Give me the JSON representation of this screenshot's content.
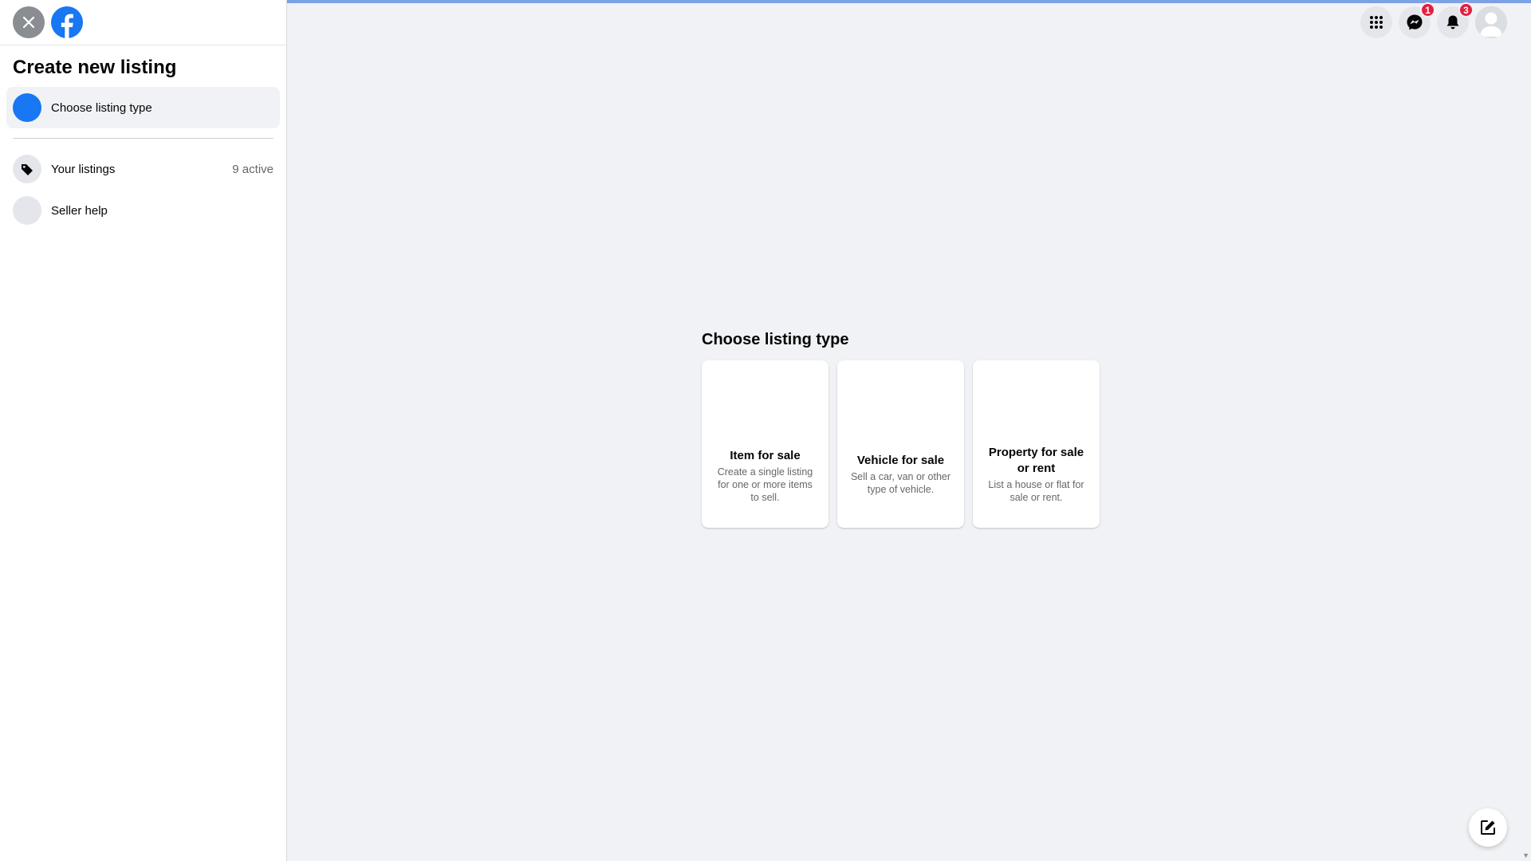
{
  "sidebar": {
    "title": "Create new listing",
    "items": [
      {
        "label": "Choose listing type",
        "meta": "",
        "icon": "step-circle-icon",
        "active": true
      },
      {
        "label": "Your listings",
        "meta": "9 active",
        "icon": "tag-icon"
      },
      {
        "label": "Seller help",
        "meta": "",
        "icon": "help-icon"
      }
    ]
  },
  "header": {
    "messenger_badge": "1",
    "notifications_badge": "3"
  },
  "main": {
    "title": "Choose listing type",
    "cards": [
      {
        "title": "Item for sale",
        "desc": "Create a single listing for one or more items to sell."
      },
      {
        "title": "Vehicle for sale",
        "desc": "Sell a car, van or other type of vehicle."
      },
      {
        "title": "Property for sale or rent",
        "desc": "List a house or flat for sale or rent."
      }
    ]
  },
  "colors": {
    "brand": "#1877f2",
    "badge": "#e41e3f",
    "page_bg": "#f0f2f5"
  }
}
